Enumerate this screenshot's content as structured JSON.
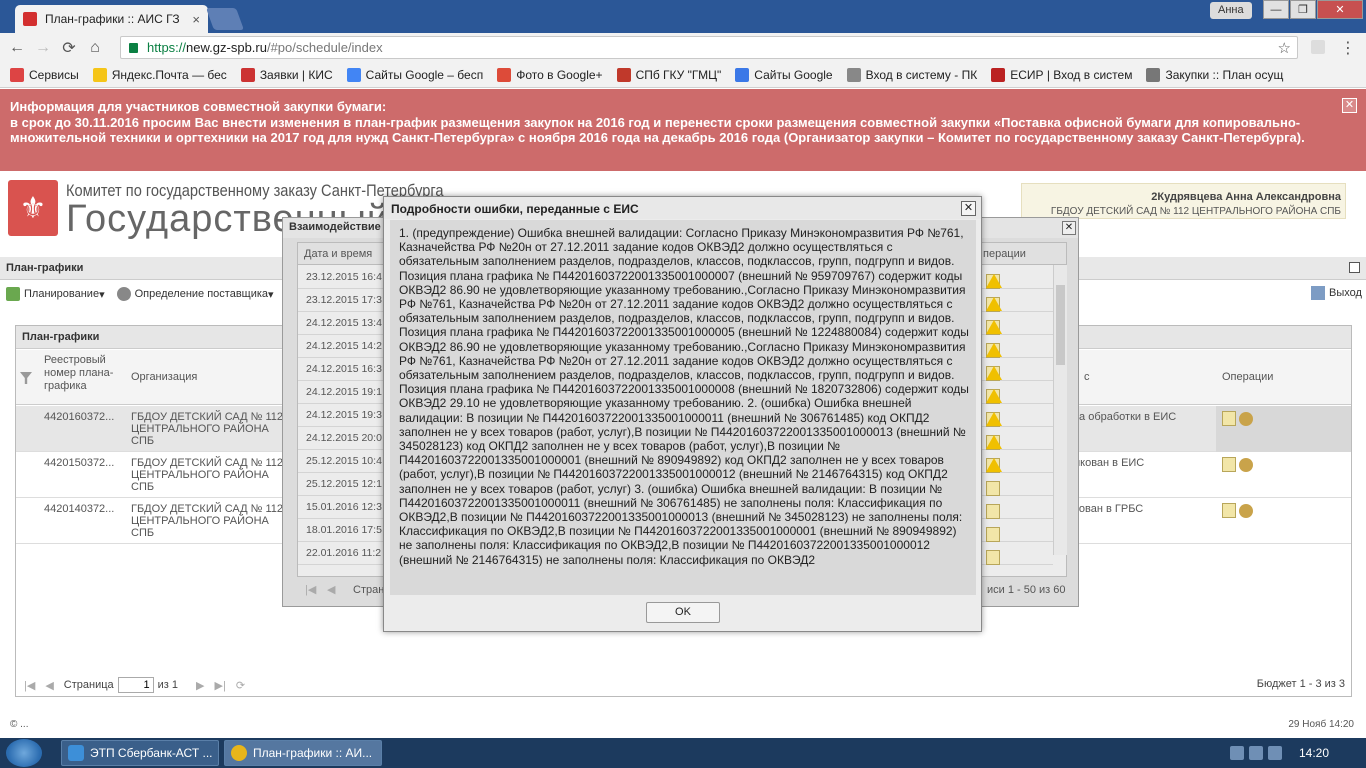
{
  "browser": {
    "tab_title": "План-графики :: АИС ГЗ",
    "tab_close": "×",
    "profile": "Анна",
    "url_scheme": "https://",
    "url_host": "new.gz-spb.ru",
    "url_path": "/#po/schedule/index",
    "bookmarks": [
      {
        "label": "Сервисы",
        "icon": "apps-icon",
        "color": "#d44"
      },
      {
        "label": "Яндекс.Почта — бес",
        "icon": "yandex-mail-icon",
        "color": "#f5c518"
      },
      {
        "label": "Заявки | КИС",
        "icon": "spb-crest-icon",
        "color": "#c33"
      },
      {
        "label": "Сайты Google – бесп",
        "icon": "google-icon",
        "color": "#4285f4"
      },
      {
        "label": "Фото в Google+",
        "icon": "google-plus-icon",
        "color": "#dd4b39"
      },
      {
        "label": "СПб ГКУ \"ГМЦ\"",
        "icon": "shield-icon",
        "color": "#c0392b"
      },
      {
        "label": "Сайты Google",
        "icon": "sites-icon",
        "color": "#3b78e7"
      },
      {
        "label": "Вход в систему - ПК",
        "icon": "login-icon",
        "color": "#888"
      },
      {
        "label": "ЕСИР | Вход в систем",
        "icon": "esir-icon",
        "color": "#b22"
      },
      {
        "label": "Закупки :: План осущ",
        "icon": "tools-icon",
        "color": "#777"
      }
    ]
  },
  "notice": {
    "line1": "Информация для участников совместной закупки бумаги:",
    "line2": "в срок до 30.11.2016 просим Вас внести изменения в план-график размещения закупок на 2016 год и перенести сроки размещения совместной закупки «Поставка офисной бумаги для копировально-множительной техники и оргтехники на 2017 год для нужд Санкт-Петербурга» с ноября 2016 года на декабрь 2016 года (Организатор закупки – Комитет по государственному заказу Санкт-Петербурга).",
    "close": "✕"
  },
  "header": {
    "org_line1": "Комитет по государственному заказу Санкт-Петербурга",
    "org_line2": "Государственный з",
    "user": "2Кудрявцева Анна Александровна",
    "user_org": "ГБДОУ ДЕТСКИЙ САД № 112 ЦЕНТРАЛЬНОГО РАЙОНА СПБ"
  },
  "panel": {
    "title": "План-графики",
    "toolbar_planning": "Планирование",
    "toolbar_supplier": "Определение поставщика",
    "exit": "Выход"
  },
  "grid": {
    "title": "План-графики",
    "col_reg": "Реестровый номер плана-графика",
    "col_org": "Организация",
    "col_status_tail": "с",
    "col_ops": "Операции",
    "rows": [
      {
        "reg": "4420160372...",
        "org": "ГБДОУ ДЕТСКИЙ САД № 112 ЦЕНТРАЛЬНОГО РАЙОНА СПБ",
        "status": "ка обработки в ЕИС"
      },
      {
        "reg": "4420150372...",
        "org": "ГБДОУ ДЕТСКИЙ САД № 112 ЦЕНТРАЛЬНОГО РАЙОНА СПБ",
        "status": "икован в ЕИС"
      },
      {
        "reg": "4420140372...",
        "org": "ГБДОУ ДЕТСКИЙ САД № 112 ЦЕНТРАЛЬНОГО РАЙОНА СПБ",
        "status": "кован в ГРБС"
      }
    ],
    "pager_page": "Страница",
    "pager_value": "1",
    "pager_of": "из 1",
    "pager_info": "Бюджет 1 - 3 из 3"
  },
  "bg_dialog": {
    "title": "Взаимодействие",
    "col_date": "Дата и время",
    "col_ops": "перации",
    "rows": [
      "23.12.2015 16:4",
      "23.12.2015 17:3",
      "24.12.2015 13:4",
      "24.12.2015 14:2",
      "24.12.2015 16:3",
      "24.12.2015 19:1",
      "24.12.2015 19:3",
      "24.12.2015 20:0",
      "25.12.2015 10:4",
      "25.12.2015 12:1",
      "15.01.2016 12:3",
      "18.01.2016 17:5",
      "22.01.2016 11:2"
    ],
    "pager_page": "Страни",
    "pager_info": "иси 1 - 50 из 60"
  },
  "modal": {
    "title": "Подробности ошибки, переданные с ЕИС",
    "close": "✕",
    "body": "1. (предупреждение) Ошибка внешней валидации: Согласно Приказу Минэкономразвития РФ №761, Казначейства РФ №20н от 27.12.2011 задание кодов ОКВЭД2 должно осуществляться с обязательным заполнением разделов, подразделов, классов, подклассов, групп, подгрупп и видов. Позиция плана графика № П44201603722001335001000007 (внешний № 959709767) содержит коды ОКВЭД2 86.90 не удовлетворяющие указанному требованию.,Согласно Приказу Минэкономразвития РФ №761, Казначейства РФ №20н от 27.12.2011 задание кодов ОКВЭД2 должно осуществляться с обязательным заполнением разделов, подразделов, классов, подклассов, групп, подгрупп и видов. Позиция плана графика № П44201603722001335001000005 (внешний № 1224880084) содержит коды ОКВЭД2 86.90 не удовлетворяющие указанному требованию.,Согласно Приказу Минэкономразвития РФ №761, Казначейства РФ №20н от 27.12.2011 задание кодов ОКВЭД2 должно осуществляться с обязательным заполнением разделов, подразделов, классов, подклассов, групп, подгрупп и видов. Позиция плана графика № П44201603722001335001000008 (внешний № 1820732806) содержит коды ОКВЭД2 29.10 не удовлетворяющие указанному требованию. 2. (ошибка) Ошибка внешней валидации: В позиции № П44201603722001335001000011 (внешний № 306761485) код ОКПД2 заполнен не у всех товаров (работ, услуг),В позиции № П44201603722001335001000013 (внешний № 345028123) код ОКПД2 заполнен не у всех товаров (работ, услуг),В позиции № П44201603722001335001000001 (внешний № 890949892) код ОКПД2 заполнен не у всех товаров (работ, услуг),В позиции № П44201603722001335001000012 (внешний № 2146764315) код ОКПД2 заполнен не у всех товаров (работ, услуг) 3. (ошибка) Ошибка внешней валидации: В позиции № П44201603722001335001000011 (внешний № 306761485) не заполнены поля: Классификация по ОКВЭД2,В позиции № П44201603722001335001000013 (внешний № 345028123) не заполнены поля: Классификация по ОКВЭД2,В позиции № П44201603722001335001000001 (внешний № 890949892) не заполнены поля: Классификация по ОКВЭД2,В позиции № П44201603722001335001000012 (внешний № 2146764315) не заполнены поля: Классификация по ОКВЭД2",
    "ok": "OK"
  },
  "status": {
    "left": "© ...",
    "right": "29 Нояб 14:20"
  },
  "taskbar": {
    "item1": "ЭТП Сбербанк-АСТ ...",
    "item2": "План-графики :: АИ...",
    "clock": "14:20"
  }
}
